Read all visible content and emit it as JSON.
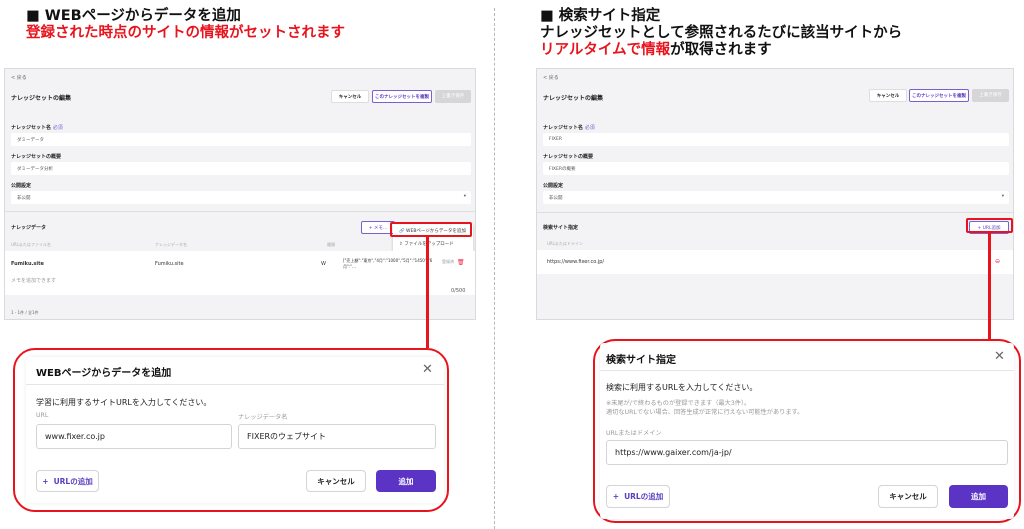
{
  "left": {
    "heading_line1": "■ WEBページからデータを追加",
    "heading_line2": "登録された時点のサイトの情報がセットされます",
    "mini": {
      "back": "< 戻る",
      "page_title": "ナレッジセットの編集",
      "cancel": "キャンセル",
      "copy": "このナレッジセットを複製",
      "save": "上書き保存",
      "name_label": "ナレッジセット名",
      "required": "必須",
      "name_value": "ダミーデータ",
      "summary_label": "ナレッジセットの概要",
      "summary_value": "ダミーデータ分析",
      "publish_label": "公開設定",
      "publish_value": "非公開",
      "knowledge_label": "ナレッジデータ",
      "memo_btn": "+ メモ…",
      "menu_web": "WEBページからデータを追加",
      "menu_file": "ファイルをアップロード",
      "col1": "URLまたはファイル名",
      "col2": "ナレッジデータ名",
      "col3": "種類",
      "row_url": "Fumiku.site",
      "row_name": "Fumiku.site",
      "row_type": "W",
      "row_data": "[\"売上額\":\"東京\",\"4月\":\"1000\",\"5月\":\"1450\",\"6月\":\"…",
      "row_status": "登録済",
      "memo_placeholder": "メモを追加できます",
      "counter": "0/500",
      "paging": "1 - 1件 / 全1件"
    },
    "dialog": {
      "title": "WEBページからデータを追加",
      "instruction": "学習に利用するサイトURLを入力してください。",
      "url_label": "URL",
      "name_label": "ナレッジデータ名",
      "url_value": "www.fixer.co.jp",
      "name_value": "FIXERのウェブサイト",
      "add_url": "URLの追加",
      "cancel": "キャンセル",
      "submit": "追加"
    }
  },
  "right": {
    "heading_line1": "■ 検索サイト指定",
    "heading_line2": "ナレッジセットとして参照されるたびに該当サイトから",
    "heading_line3_red": "リアルタイムで情報",
    "heading_line3_rest": "が取得されます",
    "mini": {
      "back": "< 戻る",
      "page_title": "ナレッジセットの編集",
      "cancel": "キャンセル",
      "copy": "このナレッジセットを複製",
      "save": "上書き保存",
      "name_label": "ナレッジセット名",
      "required": "必須",
      "name_value": "FIXER",
      "summary_label": "ナレッジセットの概要",
      "summary_value": "FIXERの概要",
      "publish_label": "公開設定",
      "publish_value": "非公開",
      "search_label": "検索サイト指定",
      "url_add_btn": "+ URL追加",
      "col1": "URLまたはドメイン",
      "row_url": "https://www.fixer.co.jp/"
    },
    "dialog": {
      "title": "検索サイト指定",
      "instruction": "検索に利用するURLを入力してください。",
      "note1": "※末尾が/で終わるものが登録できます（最大3件）。",
      "note2": "適切なURLでない場合、回答生成が正常に行えない可能性があります。",
      "url_label": "URLまたはドメイン",
      "url_value": "https://www.gaixer.com/ja-jp/",
      "add_url": "URLの追加",
      "cancel": "キャンセル",
      "submit": "追加"
    }
  }
}
